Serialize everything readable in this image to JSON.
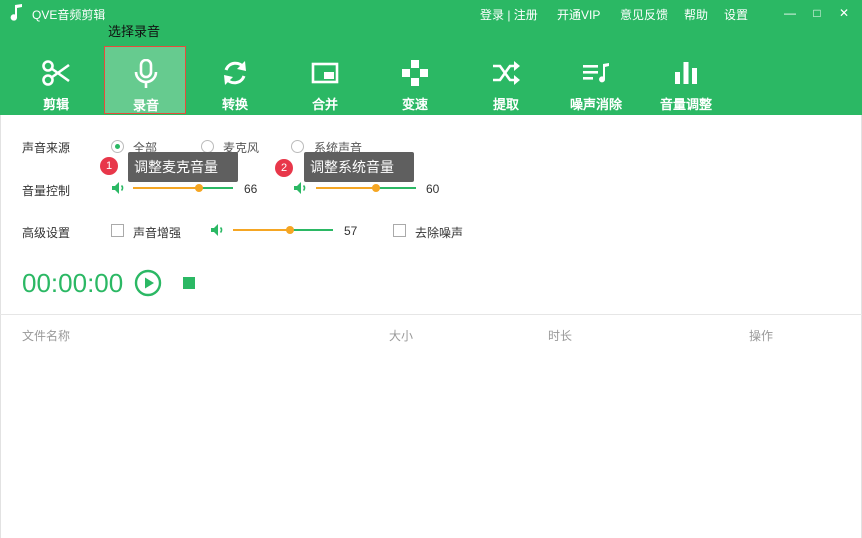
{
  "app": {
    "title": "QVE音频剪辑"
  },
  "top_links": {
    "login": "登录 | 注册",
    "vip": "开通VIP",
    "feedback": "意见反馈",
    "help": "帮助",
    "settings": "设置"
  },
  "window_controls": {
    "minimize": "—",
    "maximize": "□",
    "close": "✕"
  },
  "hints": {
    "select_record": "选择录音",
    "tip1_num": "1",
    "tip1_text": "调整麦克音量",
    "tip2_num": "2",
    "tip2_text": "调整系统音量"
  },
  "toolbar": [
    {
      "label": "剪辑",
      "icon": "scissors-icon"
    },
    {
      "label": "录音",
      "icon": "microphone-icon",
      "active": true
    },
    {
      "label": "转换",
      "icon": "refresh-icon"
    },
    {
      "label": "合并",
      "icon": "merge-icon"
    },
    {
      "label": "变速",
      "icon": "gamepad-icon"
    },
    {
      "label": "提取",
      "icon": "shuffle-icon"
    },
    {
      "label": "噪声消除",
      "icon": "playlist-icon"
    },
    {
      "label": "音量调整",
      "icon": "bars-icon"
    }
  ],
  "settings": {
    "source_label": "声音来源",
    "source_options": [
      "全部",
      "麦克风",
      "系统声音"
    ],
    "source_selected": "全部",
    "volume_label": "音量控制",
    "mic_volume": 66,
    "system_volume": 60,
    "advanced_label": "高级设置",
    "enhance_label": "声音增强",
    "enhance_checked": false,
    "enhance_volume": 57,
    "denoise_label": "去除噪声",
    "denoise_checked": false
  },
  "player": {
    "timer": "00:00:00"
  },
  "file_table": {
    "columns": [
      "文件名称",
      "大小",
      "时长",
      "操作"
    ]
  },
  "colors": {
    "brand_green": "#2bb864",
    "slider_orange": "#f5a623",
    "badge_red": "#e8374a",
    "tooltip_bg": "#5f5f5f"
  }
}
